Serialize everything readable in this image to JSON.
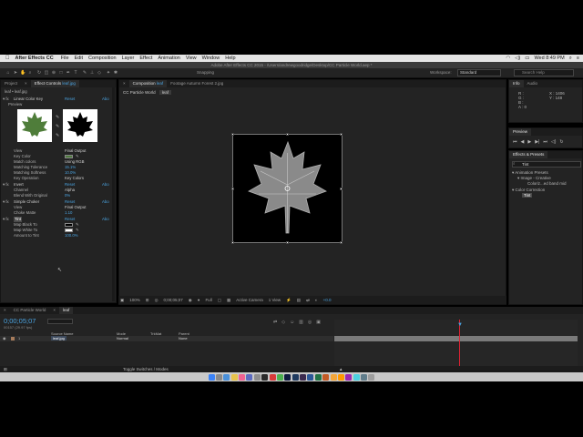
{
  "menubar": {
    "app_name": "After Effects CC",
    "items": [
      "File",
      "Edit",
      "Composition",
      "Layer",
      "Effect",
      "Animation",
      "View",
      "Window",
      "Help"
    ],
    "clock": "Wed 8:49 PM"
  },
  "title": "Adobe After Effects CC 2015 - /Users/andrewgoodridge/Desktop/CC Particle World.aep *",
  "toolbar": {
    "snapping": "Snapping",
    "workspace_label": "Workspace:",
    "workspace_value": "Standard",
    "search_placeholder": "Search Help"
  },
  "left_panel": {
    "tab_project": "Project",
    "tab_effect_controls": "Effect Controls",
    "tab_effect_target": "leaf.jpg",
    "layer_path": "leaf • leaf.jpg",
    "effects": [
      {
        "name": "Linear Color Key",
        "reset": "Reset",
        "about": "Abo"
      },
      {
        "name": "Preview"
      },
      {
        "name": "View",
        "value": "Final Output"
      },
      {
        "name": "Key Color"
      },
      {
        "name": "Match colors",
        "value": "Using RGB"
      },
      {
        "name": "Matching Tolerance",
        "value": "15.1%"
      },
      {
        "name": "Matching Softness",
        "value": "10.0%"
      },
      {
        "name": "Key Operation",
        "value": "Key Colors"
      },
      {
        "name": "Invert",
        "reset": "Reset",
        "about": "Abo"
      },
      {
        "name": "Channel",
        "value": "Alpha"
      },
      {
        "name": "Blend With Original",
        "value": "0%"
      },
      {
        "name": "Simple Choker",
        "reset": "Reset",
        "about": "Abo"
      },
      {
        "name": "View",
        "value": "Final Output"
      },
      {
        "name": "Choke Matte",
        "value": "1.10"
      },
      {
        "name": "Tint",
        "reset": "Reset",
        "about": "Abo"
      },
      {
        "name": "Map Black To"
      },
      {
        "name": "Map White To"
      },
      {
        "name": "Amount to Tint",
        "value": "100.0%"
      }
    ]
  },
  "viewer": {
    "tab_composition": "Composition",
    "tab_composition_target": "leaf",
    "tab_footage": "Footage Autumn Forest 2.jpg",
    "crumb1": "CC Particle World",
    "crumb2": "leaf",
    "zoom": "100%",
    "timecode": "0;00;05;07",
    "resolution": "Full",
    "camera": "Active Camera",
    "views": "1 View",
    "exposure": "+0.0"
  },
  "right_panel": {
    "info_tab": "Info",
    "audio_tab": "Audio",
    "info_r": "R :",
    "info_g": "G :",
    "info_b": "B :",
    "info_a": "A : 0",
    "info_x": "X : 1406",
    "info_y": "Y : 148",
    "preview_tab": "Preview",
    "effects_presets_tab": "Effects & Presets",
    "search_value": "Tint",
    "tree": [
      "▾ Animation Presets",
      "▾ Image - Creative",
      "Coloriz...ed band mid",
      "▾ Color Correction",
      "Tint"
    ]
  },
  "timeline": {
    "tab1": "CC Particle World",
    "tab2": "leaf",
    "timecode": "0;00;05;07",
    "fps": "00157 (29.97 fps)",
    "col_source": "Source Name",
    "col_mode": "Mode",
    "col_trkmat": "TrkMat",
    "col_parent": "Parent",
    "layer_num": "1",
    "layer_name": "leaf.jpg",
    "layer_mode": "Normal",
    "layer_parent": "None",
    "ruler": [
      "0f",
      "10f",
      "20f",
      "01f",
      "10f",
      "20f",
      "02f",
      "10f",
      "20f",
      "03f",
      "10f"
    ],
    "toggle_label": "Toggle Switches / Modes"
  }
}
